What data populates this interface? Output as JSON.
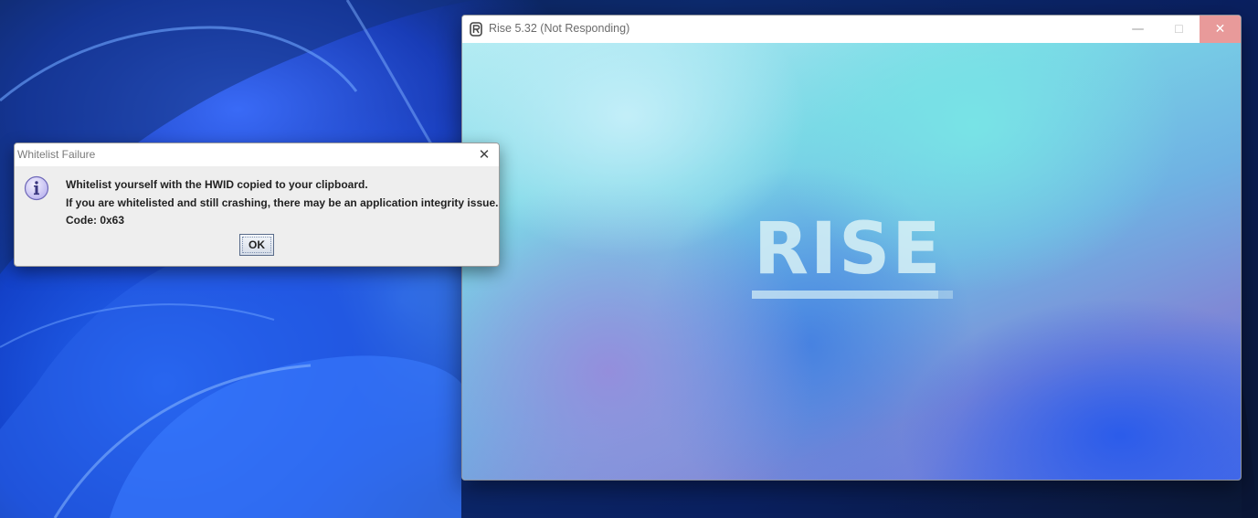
{
  "desktop": {
    "wallpaper": "windows-11-bloom"
  },
  "rise_window": {
    "title": "Rise 5.32 (Not Responding)",
    "app_icon": "rise-r-icon",
    "controls": {
      "minimize": "—",
      "maximize": "☐",
      "close": "✕"
    },
    "brand_text": "RISE",
    "close_hover_color": "#e89a9a"
  },
  "dialog": {
    "title": "Whitelist Failure",
    "close_glyph": "✕",
    "icon": "info-icon",
    "messages": [
      "Whitelist yourself with the HWID copied to your clipboard.",
      "If you are whitelisted and still crashing, there may be an application integrity issue.",
      "Code: 0x63"
    ],
    "ok_label": "OK"
  }
}
